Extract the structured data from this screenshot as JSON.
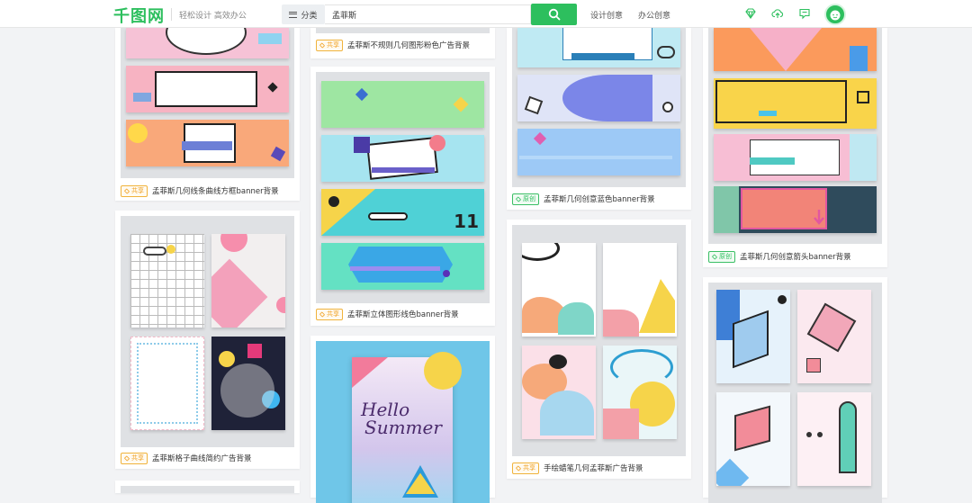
{
  "header": {
    "logo": "千图网",
    "slogan": "轻松设计 高效办公",
    "category_label": "分类",
    "search_value": "孟菲斯",
    "nav_design": "设计创意",
    "nav_office": "办公创意",
    "accent_color": "#2dbf5e",
    "icons": [
      "diamond-icon",
      "upload-icon",
      "message-icon",
      "avatar"
    ]
  },
  "badges": {
    "share": "共享",
    "original": "原创"
  },
  "cards": [
    {
      "title": "孟菲斯几何线条曲线方框banner背景",
      "badge": "共享"
    },
    {
      "title": "孟菲斯格子曲线简约广告背景",
      "badge": "共享"
    },
    {
      "title": "孟菲斯不规则几何图形粉色广告背景",
      "badge": "共享"
    },
    {
      "title": "孟菲斯立体图形线色banner背景",
      "badge": "共享"
    },
    {
      "title": "孟菲斯几何创意蓝色banner背景",
      "badge": "原创"
    },
    {
      "title": "手绘蜡笔几何孟菲斯广告背景",
      "badge": "共享"
    },
    {
      "title": "孟菲斯几何创意箭头banner背景",
      "badge": "原创"
    }
  ],
  "poster_text": {
    "line1": "Hello",
    "line2": "Summer"
  },
  "banner_number": "11"
}
